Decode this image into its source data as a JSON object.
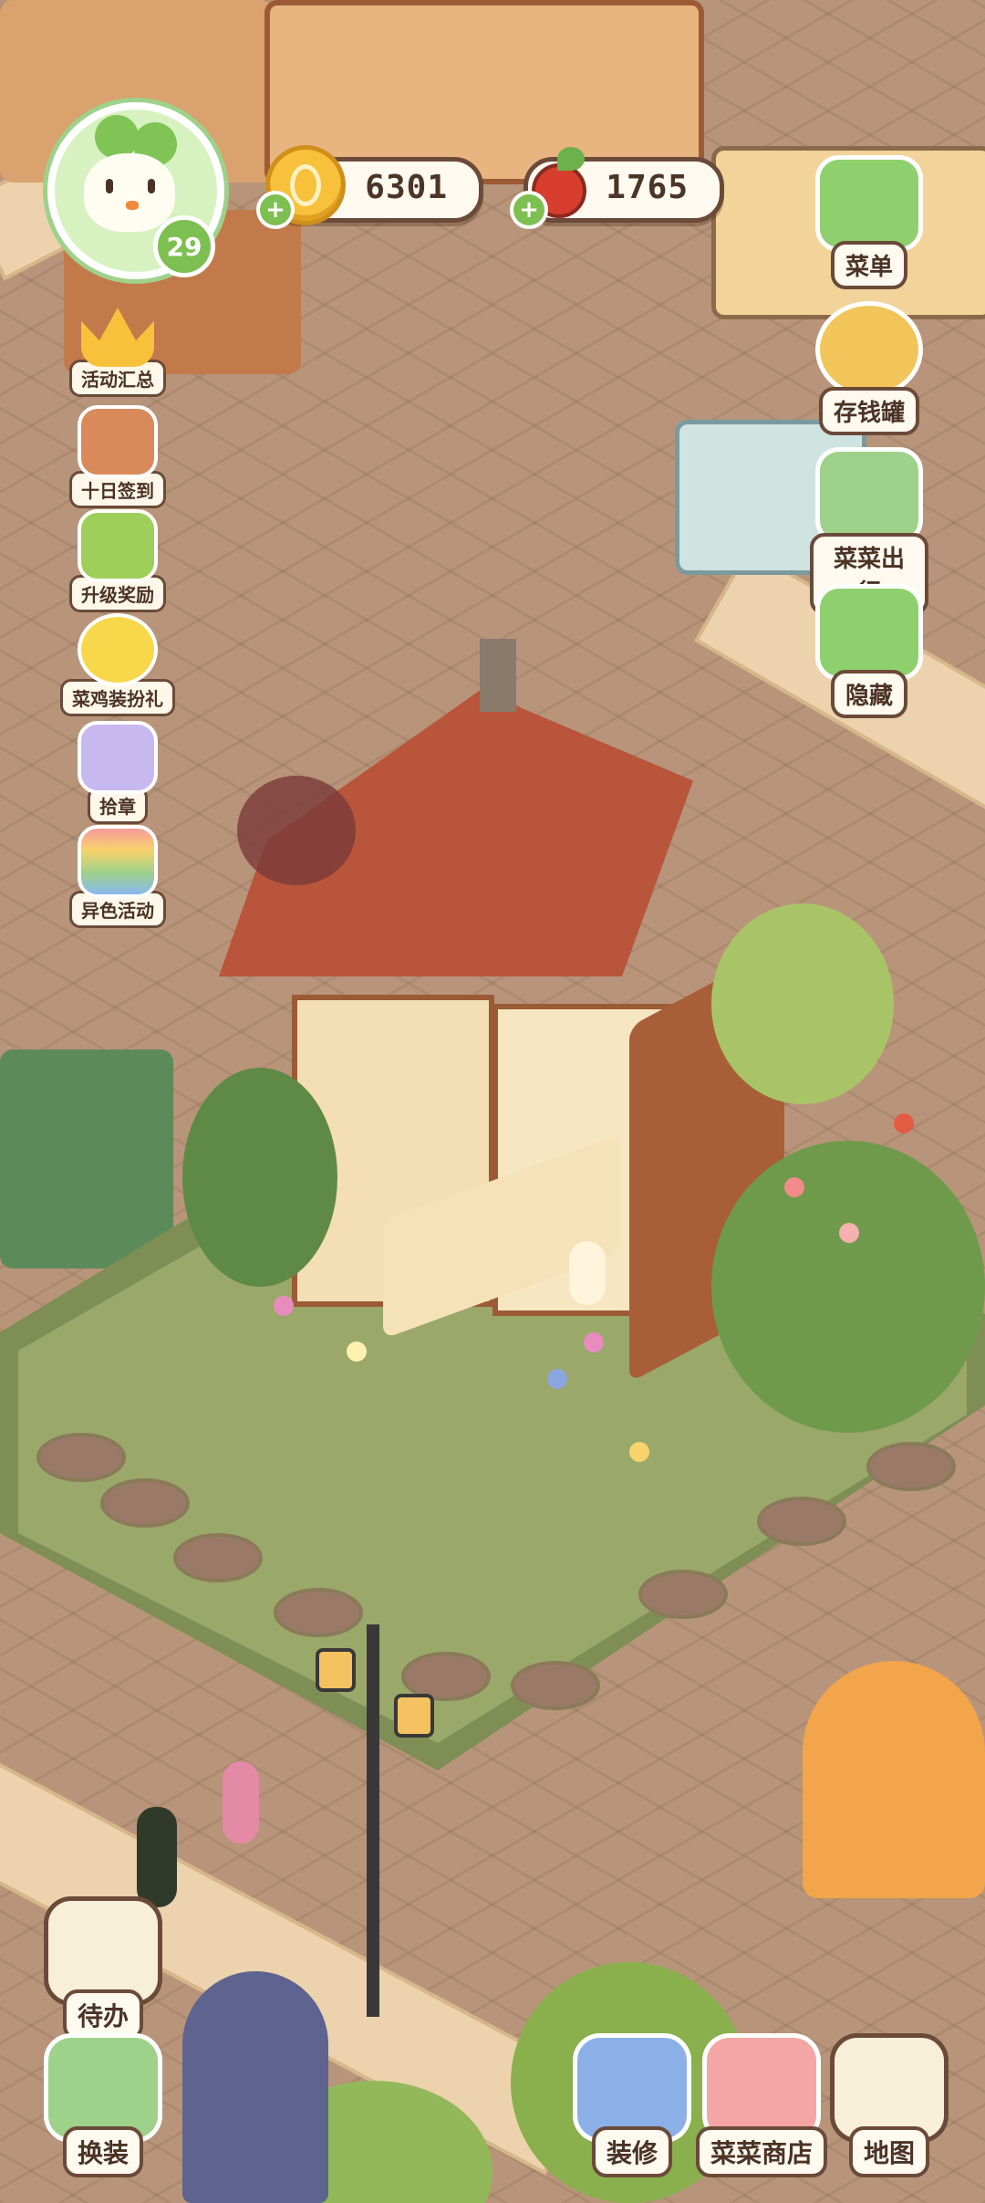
{
  "player": {
    "level": "29",
    "avatar_icon": "radish-chick-avatar-icon"
  },
  "currencies": [
    {
      "name": "coins",
      "value": "6301",
      "icon": "gold-coin-icon",
      "color": "#f7c13c"
    },
    {
      "name": "radishes",
      "value": "1765",
      "icon": "red-radish-icon",
      "color": "#d73e2e"
    }
  ],
  "left_menu": [
    {
      "label": "活动汇总",
      "icon": "crown-icon"
    },
    {
      "label": "十日签到",
      "icon": "gift-pot-icon"
    },
    {
      "label": "升级奖励",
      "icon": "level-up-arrows-icon"
    },
    {
      "label": "菜鸡装扮礼",
      "icon": "yellow-duck-icon"
    },
    {
      "label": "拾章",
      "icon": "stamp-bag-icon"
    },
    {
      "label": "异色活动",
      "icon": "rainbow-icon"
    }
  ],
  "right_menu": [
    {
      "label": "菜单",
      "icon": "menu-list-icon"
    },
    {
      "label": "存钱罐",
      "icon": "piggy-bank-icon"
    },
    {
      "label": "菜菜出行",
      "icon": "travel-leaf-icon"
    },
    {
      "label": "隐藏",
      "icon": "hide-frame-icon"
    }
  ],
  "bottom_left": [
    {
      "label": "待办",
      "icon": "todo-checklist-icon"
    },
    {
      "label": "换装",
      "icon": "dress-up-icon"
    }
  ],
  "bottom_right": [
    {
      "label": "装修",
      "icon": "renovate-bird-icon"
    },
    {
      "label": "菜菜商店",
      "icon": "shop-bag-icon"
    },
    {
      "label": "地图",
      "icon": "map-icon"
    }
  ],
  "colors": {
    "accent_green": "#7ebf52",
    "outline_brown": "#6b4a39",
    "label_bg": "#fffaf0"
  }
}
